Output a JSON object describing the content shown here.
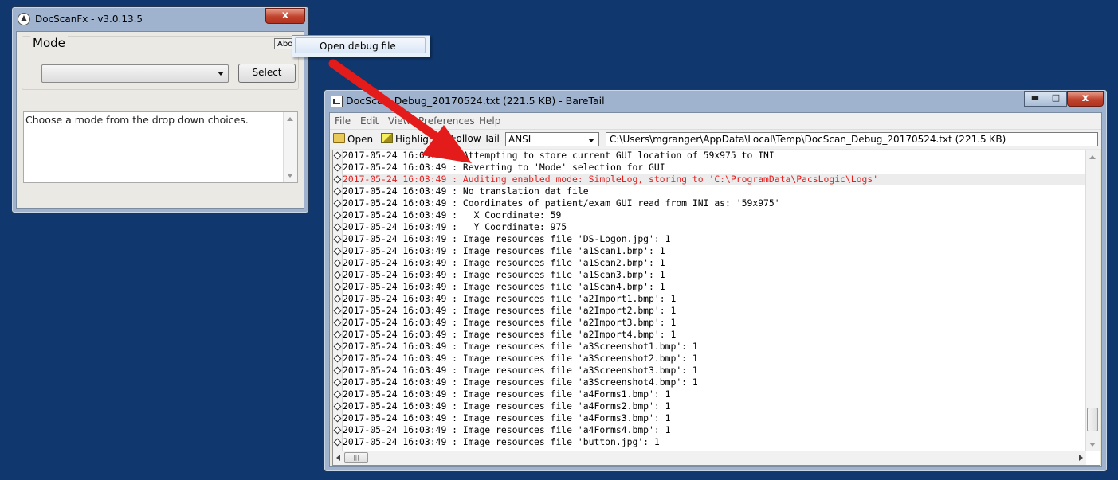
{
  "docscan": {
    "title": "DocScanFx  -  v3.0.13.5",
    "close_label": "x",
    "group_label": "Mode",
    "about_label": "About",
    "mode_combo_value": "",
    "select_label": "Select",
    "instructions": "Choose a mode from the drop down choices."
  },
  "popup": {
    "item": "Open debug file"
  },
  "baretail": {
    "title": "DocScan_Debug_20170524.txt (221.5 KB) - BareTail",
    "minimize_label": "▬",
    "maximize_label": "□",
    "close_label": "x",
    "menu": [
      "File",
      "Edit",
      "View",
      "Preferences",
      "Help"
    ],
    "toolbar": {
      "open": "Open",
      "highlighting": "Highlighting",
      "follow_tail": "Follow Tail",
      "encoding": "ANSI",
      "path": "C:\\Users\\mgranger\\AppData\\Local\\Temp\\DocScan_Debug_20170524.txt (221.5 KB)"
    },
    "lines": [
      "2017-05-24 16:03:49 : Attempting to store current GUI location of 59x975 to INI",
      "2017-05-24 16:03:49 : Reverting to 'Mode' selection for GUI",
      "2017-05-24 16:03:49 : Auditing enabled mode: SimpleLog, storing to 'C:\\ProgramData\\PacsLogic\\Logs'",
      "2017-05-24 16:03:49 : No translation dat file",
      "2017-05-24 16:03:49 : Coordinates of patient/exam GUI read from INI as: '59x975'",
      "2017-05-24 16:03:49 :   X Coordinate: 59",
      "2017-05-24 16:03:49 :   Y Coordinate: 975",
      "2017-05-24 16:03:49 : Image resources file 'DS-Logon.jpg': 1",
      "2017-05-24 16:03:49 : Image resources file 'a1Scan1.bmp': 1",
      "2017-05-24 16:03:49 : Image resources file 'a1Scan2.bmp': 1",
      "2017-05-24 16:03:49 : Image resources file 'a1Scan3.bmp': 1",
      "2017-05-24 16:03:49 : Image resources file 'a1Scan4.bmp': 1",
      "2017-05-24 16:03:49 : Image resources file 'a2Import1.bmp': 1",
      "2017-05-24 16:03:49 : Image resources file 'a2Import2.bmp': 1",
      "2017-05-24 16:03:49 : Image resources file 'a2Import3.bmp': 1",
      "2017-05-24 16:03:49 : Image resources file 'a2Import4.bmp': 1",
      "2017-05-24 16:03:49 : Image resources file 'a3Screenshot1.bmp': 1",
      "2017-05-24 16:03:49 : Image resources file 'a3Screenshot2.bmp': 1",
      "2017-05-24 16:03:49 : Image resources file 'a3Screenshot3.bmp': 1",
      "2017-05-24 16:03:49 : Image resources file 'a3Screenshot4.bmp': 1",
      "2017-05-24 16:03:49 : Image resources file 'a4Forms1.bmp': 1",
      "2017-05-24 16:03:49 : Image resources file 'a4Forms2.bmp': 1",
      "2017-05-24 16:03:49 : Image resources file 'a4Forms3.bmp': 1",
      "2017-05-24 16:03:49 : Image resources file 'a4Forms4.bmp': 1",
      "2017-05-24 16:03:49 : Image resources file 'button.jpg': 1"
    ],
    "highlighted_line": 2,
    "hscroll_thumb_label": "|||",
    "vscroll_thumb_label": "≡"
  },
  "colors": {
    "desktop": "#10386e",
    "highlight_text": "#e02020",
    "arrow": "#e41b1b"
  }
}
